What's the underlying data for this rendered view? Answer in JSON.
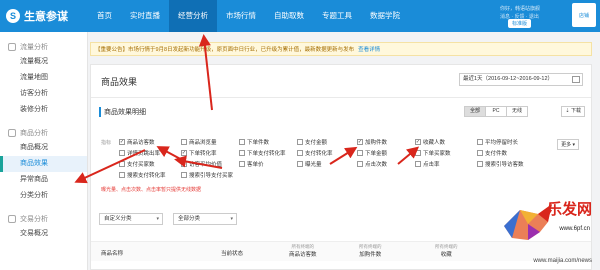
{
  "brand": {
    "name": "生意参谋",
    "mark": "S"
  },
  "nav": [
    "首页",
    "实时直播",
    "经营分析",
    "市场行情",
    "自助取数",
    "专题工具",
    "数据学院"
  ],
  "nav_active": 2,
  "user": {
    "greeting": "你好，韩语站旗舰",
    "links": "消息 · 反馈 · 退出",
    "version_label": "标准版",
    "avatar_label": "店铺"
  },
  "sidebar": {
    "groups": [
      {
        "label": "流量分析",
        "items": [
          "流量概况",
          "流量地图",
          "访客分析",
          "装修分析"
        ]
      },
      {
        "label": "商品分析",
        "items": [
          "商品概况",
          "商品效果",
          "异常商品",
          "分类分析"
        ]
      },
      {
        "label": "交易分析",
        "items": [
          "交易概况"
        ]
      }
    ],
    "active_item": "商品效果"
  },
  "notice": {
    "text": "【重要公告】市场行情于9月8日发起新功能升级，原页面中日行业，已升级为累计值，最新数据更新与发布",
    "link": "查看详情"
  },
  "panel": {
    "title": "商品效果",
    "date_range": "最近1天（2016-09-12~2016-09-12）"
  },
  "detail": {
    "title": "商品效果明细",
    "device_tabs": [
      "全部",
      "PC",
      "无线"
    ],
    "device_active": 0,
    "download": "下载"
  },
  "metrics": {
    "prefix": "指标",
    "rows": [
      [
        {
          "label": "商品访客数",
          "checked": true
        },
        {
          "label": "商品浏览量",
          "checked": false
        },
        {
          "label": "下单件数",
          "checked": false
        },
        {
          "label": "支付金额",
          "checked": false
        },
        {
          "label": "加购件数",
          "checked": true
        },
        {
          "label": "收藏人数",
          "checked": true
        },
        {
          "label": "平均停留时长",
          "checked": false
        }
      ],
      [
        {
          "label": "详情页跳出率",
          "checked": false
        },
        {
          "label": "下单转化率",
          "checked": true
        },
        {
          "label": "下单支付转化率",
          "checked": false
        },
        {
          "label": "支付转化率",
          "checked": false
        },
        {
          "label": "下单金额",
          "checked": false
        },
        {
          "label": "下单买家数",
          "checked": false
        },
        {
          "label": "支付件数",
          "checked": false
        }
      ],
      [
        {
          "label": "支付买家数",
          "checked": false
        },
        {
          "label": "访客平均价值",
          "checked": false
        },
        {
          "label": "客单价",
          "checked": false
        },
        {
          "label": "曝光量",
          "checked": false
        },
        {
          "label": "点击次数",
          "checked": false
        },
        {
          "label": "点击率",
          "checked": false
        },
        {
          "label": "搜索引导访客数",
          "checked": false
        }
      ],
      [
        {
          "label": "搜索支付转化率",
          "checked": false
        },
        {
          "label": "搜索引导支付买家",
          "checked": false
        }
      ]
    ],
    "more": "更多",
    "warning": "曝光量、点击次数、点击率暂只提供无线数据"
  },
  "filters": [
    "自定义分类",
    "全部分类"
  ],
  "table_headers": [
    {
      "label": "商品名称",
      "sub": ""
    },
    {
      "label": "当前状态",
      "sub": ""
    },
    {
      "label": "商品访客数",
      "sub": "所有终端的"
    },
    {
      "label": "加购件数",
      "sub": "所有终端的"
    },
    {
      "label": "收藏",
      "sub": "所有终端的"
    }
  ],
  "watermark": {
    "title": "乐发网",
    "url": "www.6pf.cn",
    "bottom": "www.maijia.com/news"
  },
  "colors": {
    "topbar": "#1a8cd8",
    "accent": "#1a8cd8",
    "arrow": "#d9261c",
    "active_side_border": "#1aa39a"
  }
}
